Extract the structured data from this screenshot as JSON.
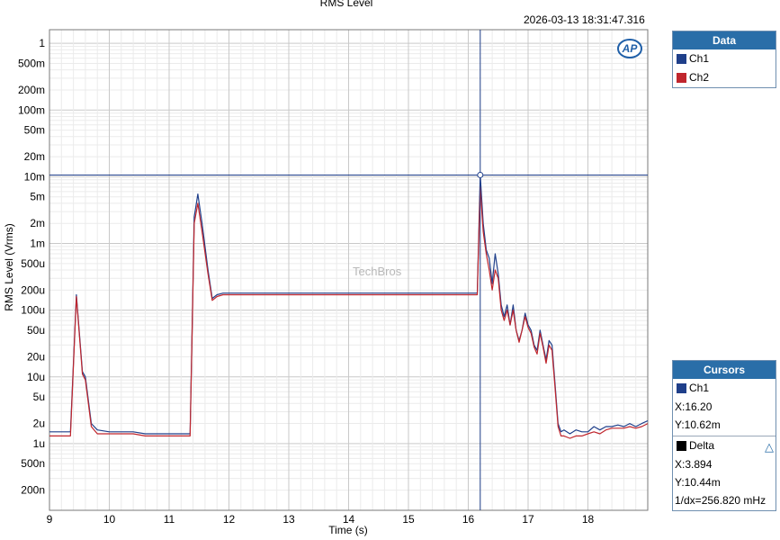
{
  "chart_data": {
    "type": "line",
    "title": "RMS Level",
    "timestamp": "2026-03-13 18:31:47.316",
    "xlabel": "Time (s)",
    "ylabel": "RMS Level (Vrms)",
    "xlim": [
      9,
      19
    ],
    "ylim": [
      1e-07,
      1.6
    ],
    "yscale": "log",
    "x_ticks": [
      9,
      10,
      11,
      12,
      13,
      14,
      15,
      16,
      17,
      18
    ],
    "x_tick_labels": [
      "9",
      "10",
      "11",
      "12",
      "13",
      "14",
      "15",
      "16",
      "17",
      "18"
    ],
    "y_ticks": [
      1,
      0.5,
      0.2,
      0.1,
      0.05,
      0.02,
      0.01,
      0.005,
      0.002,
      0.001,
      0.0005,
      0.0002,
      0.0001,
      5e-05,
      2e-05,
      1e-05,
      5e-06,
      2e-06,
      1e-06,
      5e-07,
      2e-07
    ],
    "y_tick_labels": [
      "1",
      "500m",
      "200m",
      "100m",
      "50m",
      "20m",
      "10m",
      "5m",
      "2m",
      "1m",
      "500u",
      "200u",
      "100u",
      "50u",
      "20u",
      "10u",
      "5u",
      "2u",
      "1u",
      "500n",
      "200n"
    ],
    "grid": true,
    "watermark": "TechBros",
    "series": [
      {
        "name": "Ch1",
        "color": "#1f3f8a",
        "x": [
          9.0,
          9.2,
          9.35,
          9.45,
          9.55,
          9.6,
          9.7,
          9.8,
          10.0,
          10.2,
          10.4,
          10.6,
          10.8,
          11.0,
          11.2,
          11.35,
          11.42,
          11.48,
          11.55,
          11.65,
          11.72,
          11.8,
          11.9,
          12.0,
          12.2,
          12.4,
          12.6,
          12.8,
          13.0,
          13.2,
          13.4,
          13.6,
          13.8,
          14.0,
          14.2,
          14.4,
          14.6,
          14.8,
          15.0,
          15.2,
          15.4,
          15.6,
          15.8,
          16.0,
          16.1,
          16.15,
          16.2,
          16.25,
          16.3,
          16.35,
          16.4,
          16.45,
          16.5,
          16.55,
          16.6,
          16.65,
          16.7,
          16.75,
          16.8,
          16.85,
          16.9,
          16.95,
          17.0,
          17.05,
          17.1,
          17.15,
          17.2,
          17.25,
          17.3,
          17.35,
          17.4,
          17.45,
          17.5,
          17.55,
          17.6,
          17.7,
          17.8,
          17.9,
          18.0,
          18.1,
          18.2,
          18.3,
          18.4,
          18.5,
          18.6,
          18.7,
          18.8,
          18.9,
          19.0
        ],
        "values": [
          1.5e-06,
          1.5e-06,
          1.5e-06,
          0.00017,
          1.2e-05,
          1e-05,
          2e-06,
          1.6e-06,
          1.5e-06,
          1.5e-06,
          1.5e-06,
          1.4e-06,
          1.4e-06,
          1.4e-06,
          1.4e-06,
          1.4e-06,
          0.0025,
          0.0055,
          0.002,
          0.0004,
          0.00015,
          0.00017,
          0.00018,
          0.00018,
          0.00018,
          0.00018,
          0.00018,
          0.00018,
          0.00018,
          0.00018,
          0.00018,
          0.00018,
          0.00018,
          0.00018,
          0.00018,
          0.00018,
          0.00018,
          0.00018,
          0.00018,
          0.00018,
          0.00018,
          0.00018,
          0.00018,
          0.00018,
          0.00018,
          0.00018,
          0.01062,
          0.002,
          0.0008,
          0.0006,
          0.00025,
          0.0007,
          0.00035,
          0.00012,
          8e-05,
          0.00012,
          6e-05,
          0.00012,
          5e-05,
          3.5e-05,
          5e-05,
          9e-05,
          6e-05,
          5e-05,
          3e-05,
          2.5e-05,
          5e-05,
          3e-05,
          1.8e-05,
          3.5e-05,
          3e-05,
          8e-06,
          2e-06,
          1.5e-06,
          1.6e-06,
          1.4e-06,
          1.6e-06,
          1.5e-06,
          1.5e-06,
          1.8e-06,
          1.6e-06,
          1.8e-06,
          1.8e-06,
          1.9e-06,
          1.8e-06,
          2e-06,
          1.8e-06,
          2e-06,
          2.2e-06
        ]
      },
      {
        "name": "Ch2",
        "color": "#c0262d",
        "x": [
          9.0,
          9.2,
          9.35,
          9.45,
          9.55,
          9.6,
          9.7,
          9.8,
          10.0,
          10.2,
          10.4,
          10.6,
          10.8,
          11.0,
          11.2,
          11.35,
          11.42,
          11.48,
          11.55,
          11.65,
          11.72,
          11.8,
          11.9,
          12.0,
          12.2,
          12.4,
          12.6,
          12.8,
          13.0,
          13.2,
          13.4,
          13.6,
          13.8,
          14.0,
          14.2,
          14.4,
          14.6,
          14.8,
          15.0,
          15.2,
          15.4,
          15.6,
          15.8,
          16.0,
          16.1,
          16.15,
          16.2,
          16.25,
          16.3,
          16.35,
          16.4,
          16.45,
          16.5,
          16.55,
          16.6,
          16.65,
          16.7,
          16.75,
          16.8,
          16.85,
          16.9,
          16.95,
          17.0,
          17.05,
          17.1,
          17.15,
          17.2,
          17.25,
          17.3,
          17.35,
          17.4,
          17.45,
          17.5,
          17.55,
          17.6,
          17.7,
          17.8,
          17.9,
          18.0,
          18.1,
          18.2,
          18.3,
          18.4,
          18.5,
          18.6,
          18.7,
          18.8,
          18.9,
          19.0
        ],
        "values": [
          1.3e-06,
          1.3e-06,
          1.3e-06,
          0.00016,
          1.1e-05,
          9e-06,
          1.8e-06,
          1.4e-06,
          1.4e-06,
          1.4e-06,
          1.4e-06,
          1.3e-06,
          1.3e-06,
          1.3e-06,
          1.3e-06,
          1.3e-06,
          0.002,
          0.004,
          0.0015,
          0.00035,
          0.00014,
          0.00016,
          0.00017,
          0.00017,
          0.00017,
          0.00017,
          0.00017,
          0.00017,
          0.00017,
          0.00017,
          0.00017,
          0.00017,
          0.00017,
          0.00017,
          0.00017,
          0.00017,
          0.00017,
          0.00017,
          0.00017,
          0.00017,
          0.00017,
          0.00017,
          0.00017,
          0.00017,
          0.00017,
          0.00017,
          0.007,
          0.0015,
          0.0007,
          0.0004,
          0.0002,
          0.0004,
          0.0003,
          0.0001,
          7e-05,
          0.0001,
          6e-05,
          0.0001,
          5e-05,
          3.3e-05,
          5e-05,
          8e-05,
          5.5e-05,
          4.5e-05,
          2.8e-05,
          2.2e-05,
          4.5e-05,
          2.8e-05,
          1.6e-05,
          3e-05,
          2.5e-05,
          7e-06,
          1.8e-06,
          1.3e-06,
          1.3e-06,
          1.2e-06,
          1.3e-06,
          1.3e-06,
          1.4e-06,
          1.5e-06,
          1.4e-06,
          1.6e-06,
          1.7e-06,
          1.7e-06,
          1.7e-06,
          1.8e-06,
          1.7e-06,
          1.8e-06,
          2e-06
        ]
      }
    ],
    "cursor": {
      "x": 16.2,
      "y": 0.01062
    }
  },
  "legend": {
    "title": "Data",
    "items": [
      {
        "label": "Ch1",
        "color": "#1f3f8a"
      },
      {
        "label": "Ch2",
        "color": "#c0262d"
      }
    ]
  },
  "cursors": {
    "title": "Cursors",
    "channel": {
      "label": "Ch1",
      "color": "#1f3f8a"
    },
    "x": "X:16.20",
    "y": "Y:10.62m",
    "delta_label": "Delta",
    "delta_color": "#000000",
    "delta_x": "X:3.894",
    "delta_y": "Y:10.44m",
    "inv_dx": "1/dx=256.820 mHz"
  },
  "logo": "AP"
}
